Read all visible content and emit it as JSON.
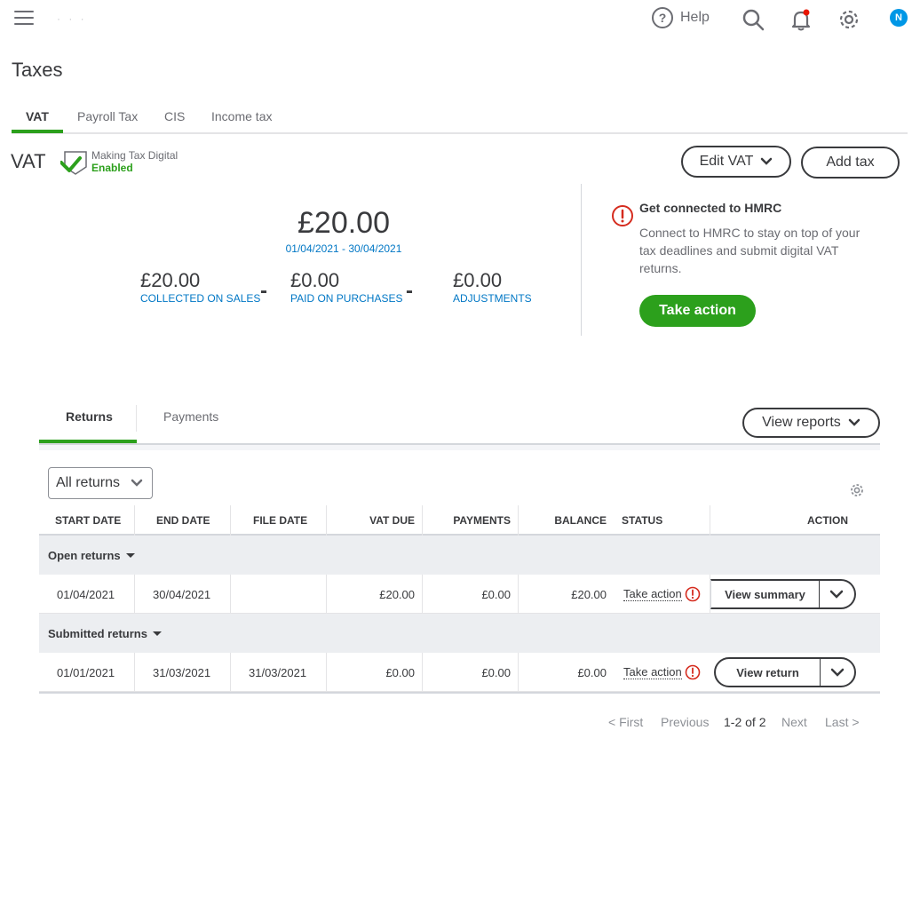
{
  "topbar": {
    "menu_icon": "hamburger-menu-icon",
    "dots": "· · ·",
    "help_label": "Help",
    "search_icon": "search-icon",
    "notifications_icon": "bell-icon",
    "settings_icon": "gear-icon",
    "avatar_initial": "N",
    "avatar_color": "#0097e6",
    "notification_dot_color": "#e81500"
  },
  "page_title": "Taxes",
  "main_tabs": [
    {
      "label": "VAT",
      "active": true
    },
    {
      "label": "Payroll Tax",
      "active": false
    },
    {
      "label": "CIS",
      "active": false
    },
    {
      "label": "Income tax",
      "active": false
    }
  ],
  "vat_section": {
    "heading": "VAT",
    "mtd_line1": "Making Tax Digital",
    "mtd_line2": "Enabled",
    "edit_vat_label": "Edit VAT",
    "add_tax_label": "Add tax"
  },
  "summary": {
    "total": "£20.00",
    "period": "01/04/2021 - 30/04/2021",
    "collected_value": "£20.00",
    "collected_label": "COLLECTED ON SALES",
    "minus1": "-",
    "paid_value": "£0.00",
    "paid_label": "PAID ON PURCHASES",
    "minus2": "-",
    "adjustments_value": "£0.00",
    "adjustments_label": "ADJUSTMENTS"
  },
  "hmrc": {
    "title": "Get connected to HMRC",
    "text": "Connect to HMRC to stay on top of your tax deadlines and submit digital VAT returns.",
    "button_label": "Take action"
  },
  "sub_tabs": [
    {
      "label": "Returns",
      "active": true
    },
    {
      "label": "Payments",
      "active": false
    }
  ],
  "view_reports_label": "View reports",
  "filter": {
    "selected": "All returns"
  },
  "table": {
    "columns": [
      "START DATE",
      "END DATE",
      "FILE DATE",
      "VAT DUE",
      "PAYMENTS",
      "BALANCE",
      "STATUS",
      "ACTION"
    ],
    "groups": [
      {
        "label": "Open returns",
        "rows": [
          {
            "start": "01/04/2021",
            "end": "30/04/2021",
            "file": "",
            "vat_due": "£20.00",
            "payments": "£0.00",
            "balance": "£20.00",
            "status": "Take action",
            "action": "View summary"
          }
        ]
      },
      {
        "label": "Submitted returns",
        "rows": [
          {
            "start": "01/01/2021",
            "end": "31/03/2021",
            "file": "31/03/2021",
            "vat_due": "£0.00",
            "payments": "£0.00",
            "balance": "£0.00",
            "status": "Take action",
            "action": "View return"
          }
        ]
      }
    ]
  },
  "pagination": {
    "first": "< First",
    "previous": "Previous",
    "range": "1-2 of 2",
    "next": "Next",
    "last": "Last >"
  },
  "colors": {
    "accent_green": "#2ca01c",
    "link_blue": "#0077c5",
    "warning_red": "#d52b1e"
  }
}
